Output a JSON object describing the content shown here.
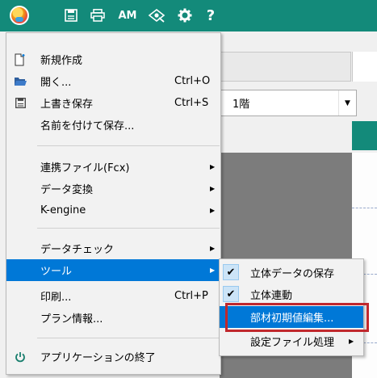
{
  "toolbar": {
    "buttons": [
      {
        "name": "app-menu",
        "icon": "app-logo-icon"
      },
      {
        "name": "save",
        "icon": "save-icon"
      },
      {
        "name": "print",
        "icon": "print-icon"
      },
      {
        "name": "am",
        "label": "AM"
      },
      {
        "name": "view-3d",
        "icon": "view-3d-icon"
      },
      {
        "name": "settings",
        "icon": "gear-icon"
      },
      {
        "name": "help",
        "label": "?"
      }
    ],
    "color": "#138a7a"
  },
  "floor_select": {
    "value": "1階"
  },
  "menu": {
    "items": [
      {
        "label": "新規作成",
        "icon": "new-file-icon",
        "shortcut": ""
      },
      {
        "label": "開く...",
        "icon": "folder-open-icon",
        "shortcut": "Ctrl+O"
      },
      {
        "label": "上書き保存",
        "icon": "save-icon",
        "shortcut": "Ctrl+S"
      },
      {
        "label": "名前を付けて保存...",
        "icon": "",
        "shortcut": ""
      },
      {
        "label": "連携ファイル(Fcx)",
        "icon": "",
        "shortcut": "",
        "submenu": true
      },
      {
        "label": "データ変換",
        "icon": "",
        "shortcut": "",
        "submenu": true
      },
      {
        "label": "K-engine",
        "icon": "",
        "shortcut": "",
        "submenu": true
      },
      {
        "label": "データチェック",
        "icon": "",
        "shortcut": "",
        "submenu": true
      },
      {
        "label": "ツール",
        "icon": "",
        "shortcut": "",
        "submenu": true,
        "active": true
      },
      {
        "label": "印刷...",
        "icon": "",
        "shortcut": "Ctrl+P"
      },
      {
        "label": "プラン情報...",
        "icon": "",
        "shortcut": ""
      },
      {
        "label": "アプリケーションの終了",
        "icon": "power-icon",
        "shortcut": ""
      }
    ]
  },
  "submenu": {
    "items": [
      {
        "label": "立体データの保存",
        "checked": true
      },
      {
        "label": "立体連動",
        "checked": true
      },
      {
        "label": "部材初期値編集...",
        "checked": false,
        "active": true
      },
      {
        "label": "設定ファイル処理",
        "checked": false,
        "submenu": true
      }
    ],
    "check_glyph": "✔"
  },
  "submenu_arrow": "▶",
  "select_arrow": "▼",
  "colors": {
    "accent": "#0078d7",
    "highlight_box": "#c0282d"
  }
}
